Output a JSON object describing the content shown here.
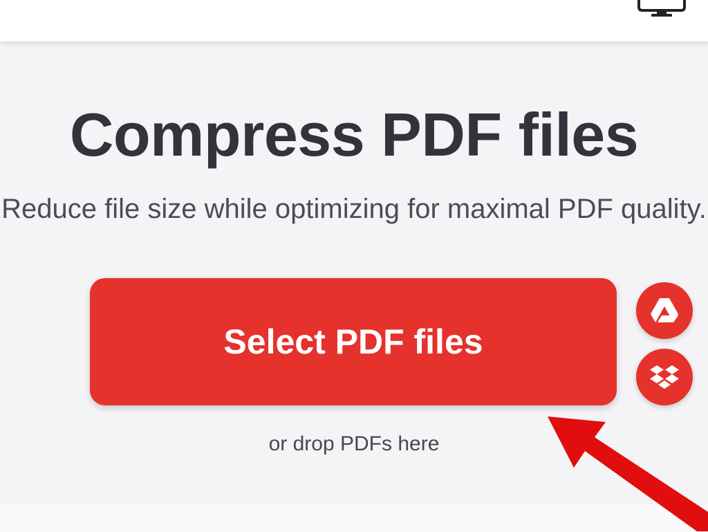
{
  "header": {
    "device_icon": "monitor-icon"
  },
  "main": {
    "title": "Compress PDF files",
    "subtitle": "Reduce file size while optimizing for maximal PDF quality.",
    "select_button_label": "Select PDF files",
    "drop_hint": "or drop PDFs here",
    "cloud_buttons": [
      {
        "icon": "google-drive-icon"
      },
      {
        "icon": "dropbox-icon"
      }
    ]
  },
  "annotation": {
    "arrow_icon": "red-arrow-icon",
    "arrow_color": "#e00e0e"
  },
  "colors": {
    "brand_red": "#e5322d",
    "title_text": "#33333b",
    "background": "#f4f4f6"
  }
}
